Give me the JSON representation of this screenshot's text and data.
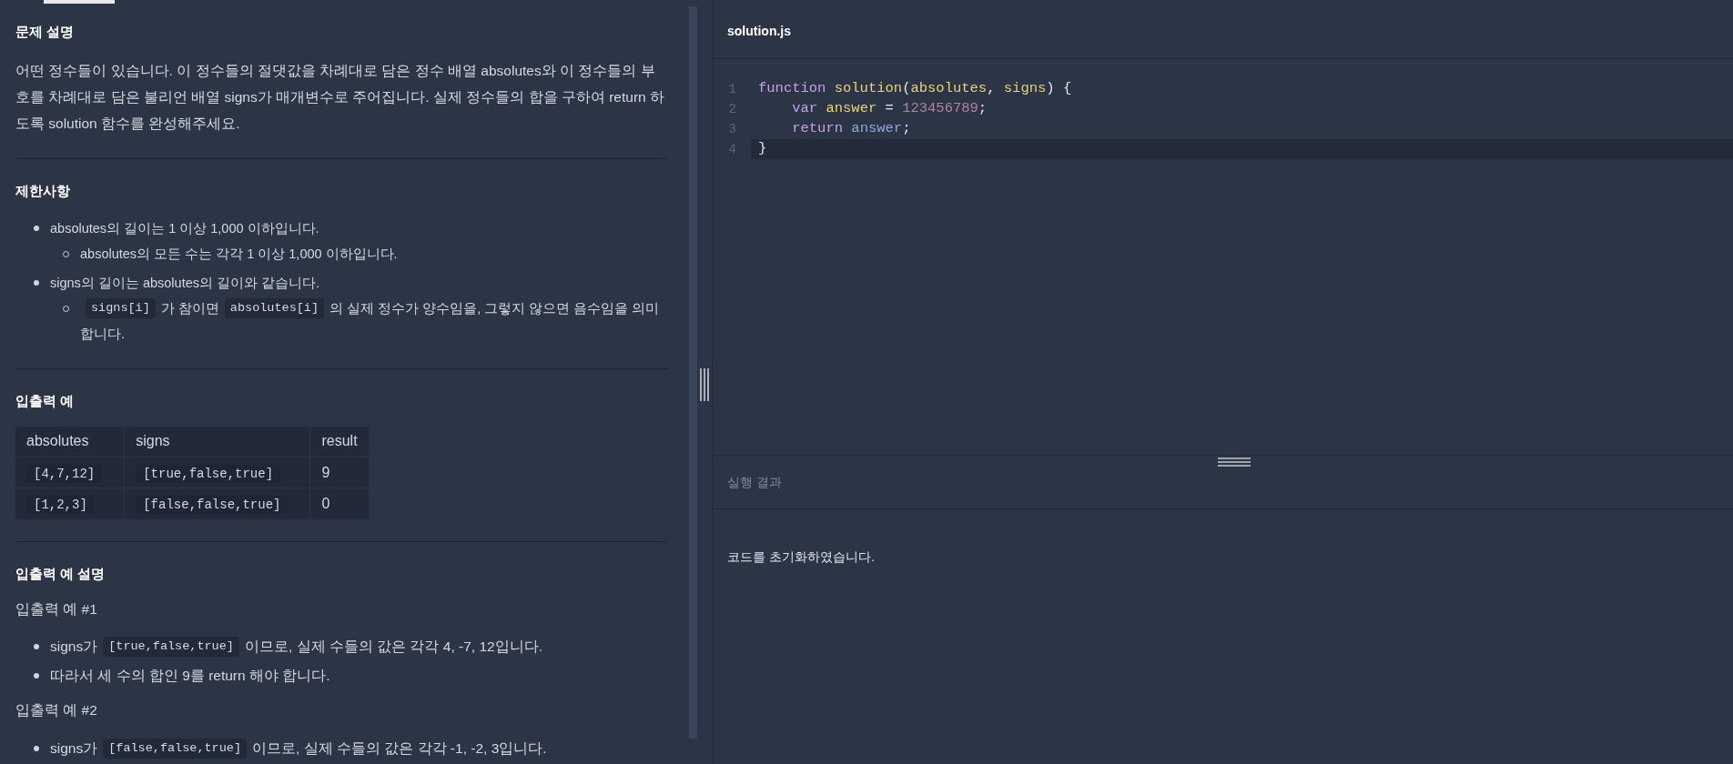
{
  "problem": {
    "title": "문제 설명",
    "description": "어떤 정수들이 있습니다. 이 정수들의 절댓값을 차례대로 담은 정수 배열 absolutes와 이 정수들의 부호를 차례대로 담은 불리언 배열 signs가 매개변수로 주어집니다. 실제 정수들의 합을 구하여 return 하도록 solution 함수를 완성해주세요."
  },
  "constraints": {
    "title": "제한사항",
    "items": [
      {
        "parts": [
          {
            "kind": "text",
            "text": "absolutes의 길이는 1 이상 1,000 이하입니다."
          }
        ],
        "children": [
          {
            "parts": [
              {
                "kind": "text",
                "text": "absolutes의 모든 수는 각각 1 이상 1,000 이하입니다."
              }
            ]
          }
        ]
      },
      {
        "parts": [
          {
            "kind": "text",
            "text": "signs의 길이는 absolutes의 길이와 같습니다."
          }
        ],
        "children": [
          {
            "parts": [
              {
                "kind": "code",
                "text": "signs[i]"
              },
              {
                "kind": "text",
                "text": "가 참이면"
              },
              {
                "kind": "code",
                "text": "absolutes[i]"
              },
              {
                "kind": "text",
                "text": "의 실제 정수가 양수임을, 그렇지 않으면 음수임을 의미"
              },
              {
                "kind": "text",
                "text": "합니다."
              }
            ]
          }
        ]
      }
    ]
  },
  "examples": {
    "title": "입출력 예",
    "columns": [
      "absolutes",
      "signs",
      "result"
    ],
    "rows": [
      [
        "[4,7,12]",
        "[true,false,true]",
        "9"
      ],
      [
        "[1,2,3]",
        "[false,false,true]",
        "0"
      ]
    ]
  },
  "explanation": {
    "title": "입출력 예 설명",
    "cases": [
      {
        "title": "입출력 예 #1",
        "items": [
          {
            "parts": [
              {
                "kind": "text",
                "text": "signs가"
              },
              {
                "kind": "code",
                "text": "[true,false,true]"
              },
              {
                "kind": "text",
                "text": "이므로, 실제 수들의 값은 각각 4, -7, 12입니다."
              }
            ]
          },
          {
            "parts": [
              {
                "kind": "text",
                "text": "따라서 세 수의 합인 9를 return 해야 합니다."
              }
            ]
          }
        ]
      },
      {
        "title": "입출력 예 #2",
        "items": [
          {
            "parts": [
              {
                "kind": "text",
                "text": "signs가"
              },
              {
                "kind": "code",
                "text": "[false,false,true]"
              },
              {
                "kind": "text",
                "text": "이므로, 실제 수들의 값은 각각 -1, -2, 3입니다."
              }
            ]
          }
        ]
      }
    ]
  },
  "editor": {
    "filename": "solution.js",
    "lines": [
      {
        "number": "1",
        "current": false,
        "tokens": [
          {
            "kind": "keyword",
            "text": "function "
          },
          {
            "kind": "name",
            "text": "solution"
          },
          {
            "kind": "plain",
            "text": "("
          },
          {
            "kind": "name",
            "text": "absolutes"
          },
          {
            "kind": "plain",
            "text": ", "
          },
          {
            "kind": "name",
            "text": "signs"
          },
          {
            "kind": "plain",
            "text": ") {"
          }
        ]
      },
      {
        "number": "2",
        "current": false,
        "tokens": [
          {
            "kind": "keyword",
            "text": "    var "
          },
          {
            "kind": "name",
            "text": "answer"
          },
          {
            "kind": "plain",
            "text": " = "
          },
          {
            "kind": "number",
            "text": "123456789"
          },
          {
            "kind": "plain",
            "text": ";"
          }
        ]
      },
      {
        "number": "3",
        "current": false,
        "tokens": [
          {
            "kind": "keyword",
            "text": "    return "
          },
          {
            "kind": "variable",
            "text": "answer"
          },
          {
            "kind": "plain",
            "text": ";"
          }
        ]
      },
      {
        "number": "4",
        "current": true,
        "tokens": [
          {
            "kind": "plain",
            "text": "}"
          }
        ]
      }
    ]
  },
  "result": {
    "title": "실행 결과",
    "message": "코드를 초기화하였습니다."
  }
}
